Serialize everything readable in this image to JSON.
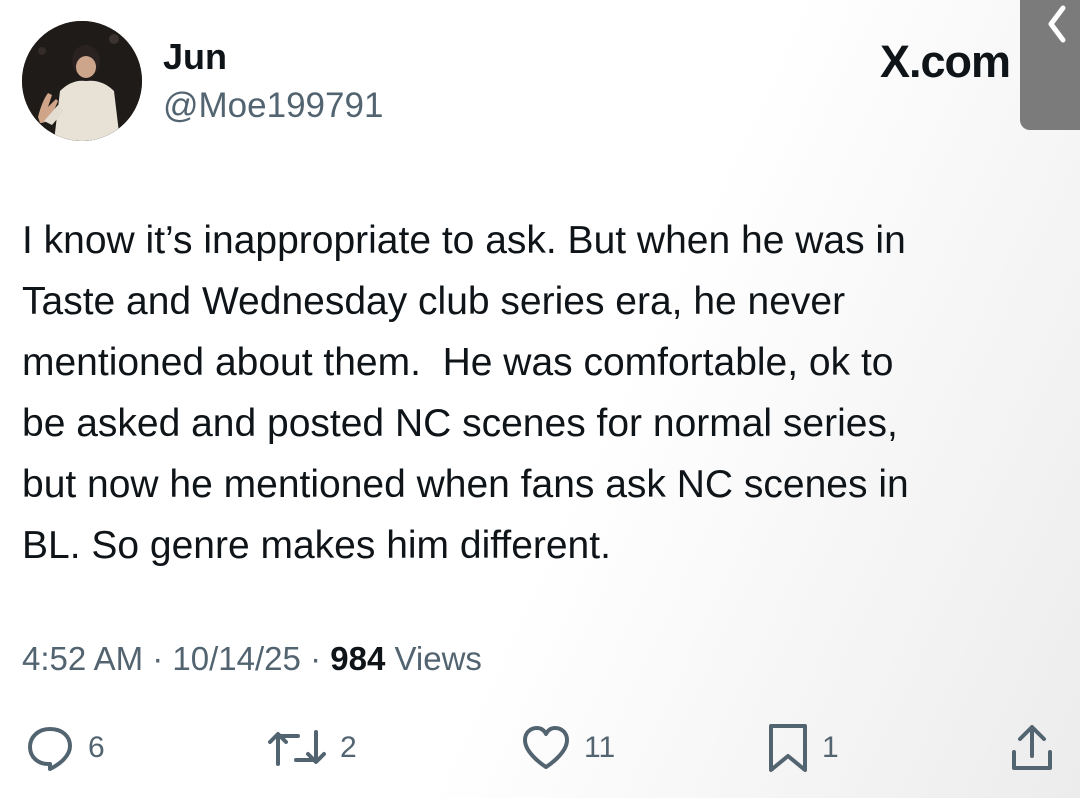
{
  "author": {
    "name": "Jun",
    "handle": "@Moe199791"
  },
  "brand": "X.com",
  "tweet": {
    "text": "I know it’s inappropriate to ask. But when he was in\nTaste and Wednesday club series era, he never\nmentioned about them.  He was comfortable, ok to\nbe asked and posted NC scenes for normal series,\nbut now he mentioned when fans ask NC scenes in\nBL. So genre makes him different."
  },
  "meta": {
    "time": "4:52 AM",
    "separator": "·",
    "date": "10/14/25",
    "views_count": "984",
    "views_label": "Views"
  },
  "actions": {
    "reply_count": "6",
    "retweet_count": "2",
    "like_count": "11",
    "bookmark_count": "1"
  },
  "icons": {
    "reply": "reply-icon",
    "retweet": "retweet-icon",
    "like": "heart-icon",
    "bookmark": "bookmark-icon",
    "share": "share-icon",
    "back": "chevron-left-icon"
  },
  "colors": {
    "text_primary": "#0f1419",
    "text_secondary": "#536471",
    "icon": "#536471"
  }
}
